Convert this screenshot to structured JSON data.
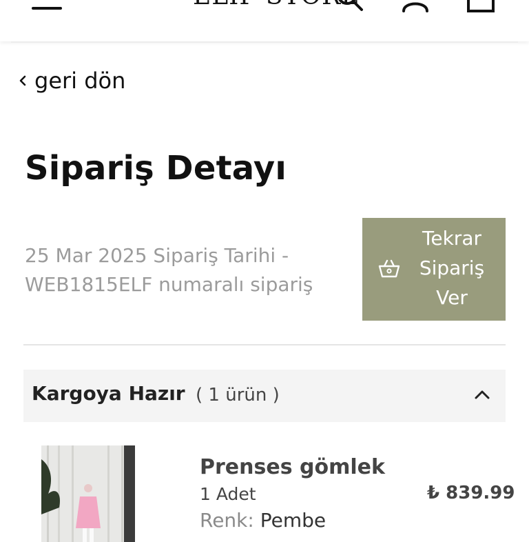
{
  "header": {
    "store_name": "ELIF STORE",
    "icons": [
      "menu-icon",
      "search-icon",
      "user-icon",
      "cart-icon"
    ]
  },
  "nav": {
    "back_label": "geri dön"
  },
  "page": {
    "title": "Sipariş Detayı"
  },
  "order": {
    "date_line": "25 Mar 2025 Sipariş Tarihi -",
    "number_line": "WEB1815ELF numaralı sipariş"
  },
  "reorder": {
    "label_lines": [
      "Tekrar",
      "Sipariş",
      "Ver"
    ],
    "background": "#999c7d",
    "icon": "basket-icon"
  },
  "shipment": {
    "status": "Kargoya Hazır",
    "count": "( 1 ürün )",
    "expanded": true
  },
  "items": [
    {
      "name": "Prenses gömlek",
      "quantity": "1 Adet",
      "price": "₺ 839.99",
      "color_label": "Renk:",
      "color_value": "Pembe"
    }
  ]
}
